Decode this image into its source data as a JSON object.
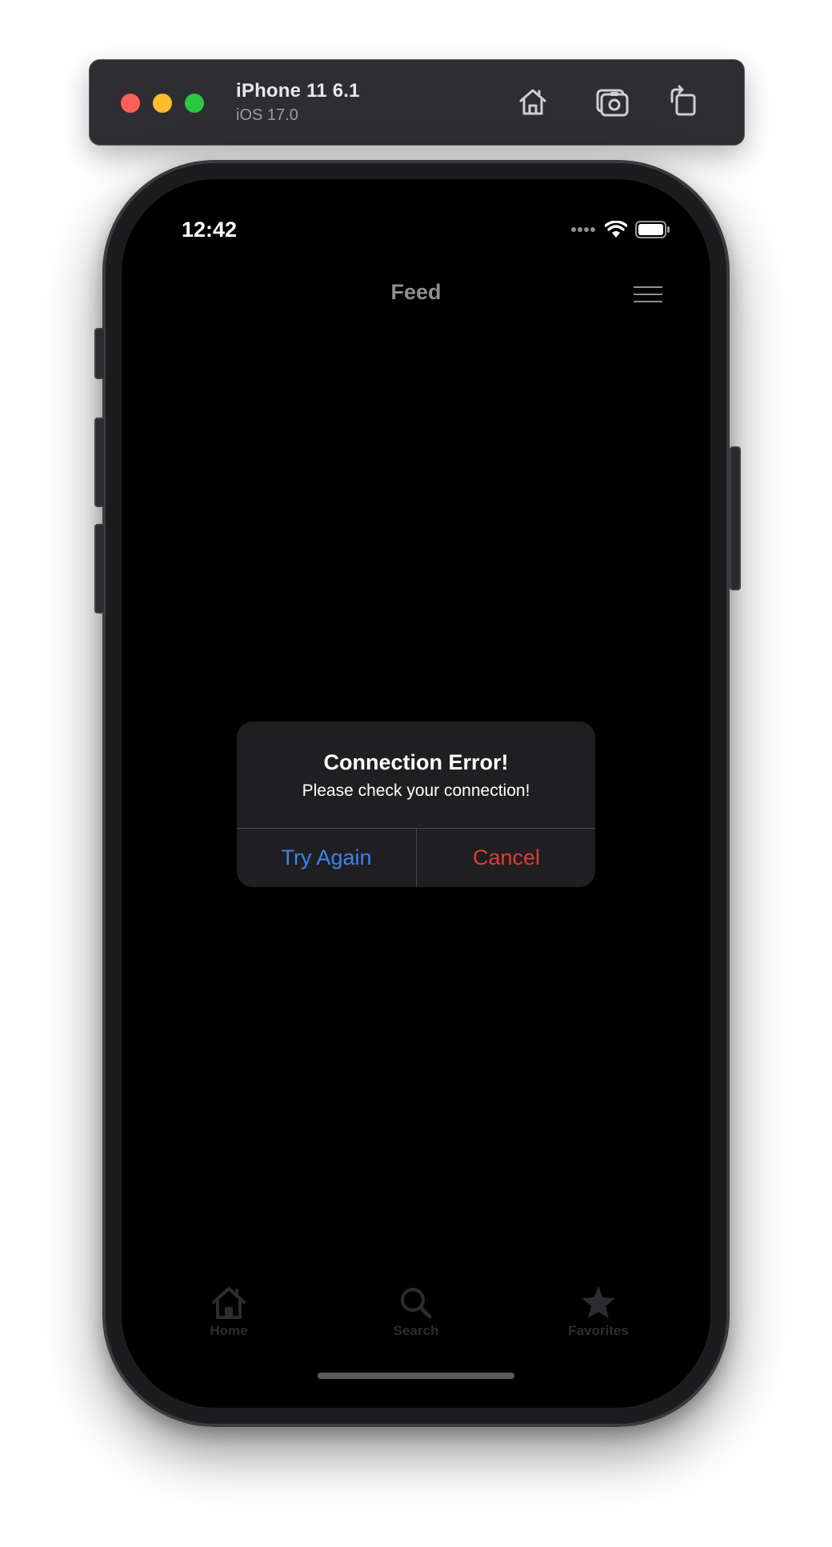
{
  "simulator": {
    "device_name": "iPhone 11 6.1",
    "os_version": "iOS 17.0",
    "icons": [
      "home-icon",
      "screenshot-icon",
      "rotate-icon"
    ]
  },
  "status_bar": {
    "time": "12:42"
  },
  "nav_bar": {
    "title": "Feed"
  },
  "alert": {
    "title": "Connection Error!",
    "message": "Please check your connection!",
    "primary_button": "Try Again",
    "cancel_button": "Cancel"
  },
  "tab_bar": {
    "items": [
      {
        "label": "Home",
        "icon": "home-icon"
      },
      {
        "label": "Search",
        "icon": "search-icon"
      },
      {
        "label": "Favorites",
        "icon": "star-icon"
      }
    ]
  },
  "colors": {
    "accent_blue": "#3b82f6",
    "destructive_red": "#e53935",
    "screen_bg": "#000000",
    "alert_bg": "#1f1f21"
  }
}
